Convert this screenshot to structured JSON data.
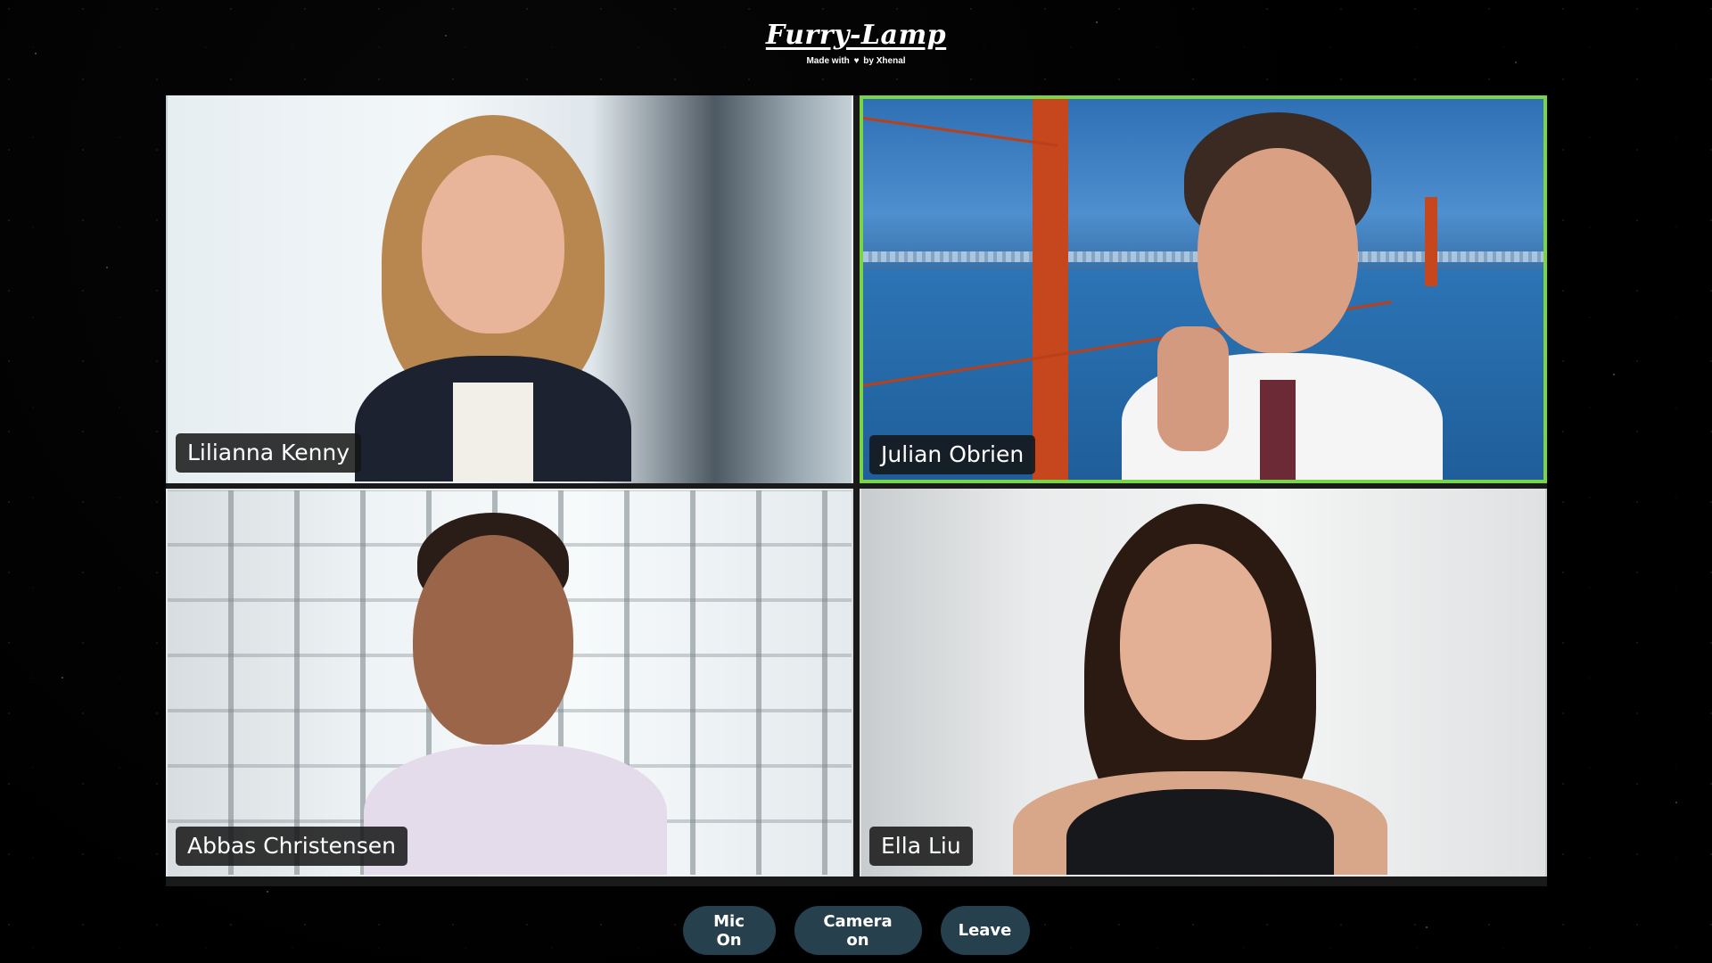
{
  "header": {
    "logo": "Furry-Lamp",
    "tagline_prefix": "Made with",
    "tagline_suffix": "by Xhenal",
    "heart_icon": "heart-icon"
  },
  "participants": [
    {
      "name": "Lilianna Kenny",
      "active": false
    },
    {
      "name": "Julian Obrien",
      "active": true
    },
    {
      "name": "Abbas Christensen",
      "active": false
    },
    {
      "name": "Ella Liu",
      "active": false
    }
  ],
  "controls": {
    "mic_label": "Mic On",
    "camera_label": "Camera on",
    "leave_label": "Leave"
  },
  "colors": {
    "active_speaker_border": "#78d646",
    "button_bg": "#26404d",
    "background": "#000000"
  }
}
